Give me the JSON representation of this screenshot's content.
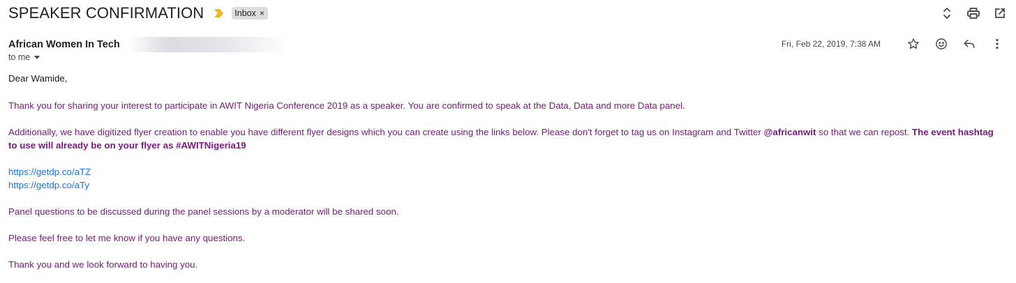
{
  "subject": "SPEAKER CONFIRMATION",
  "label_chip": {
    "text": "Inbox",
    "remove": "×"
  },
  "importance_icon": "importance-marker-icon",
  "top_actions": [
    "expand-collapse-icon",
    "print-icon",
    "open-in-new-window-icon"
  ],
  "sender": {
    "name": "African Women In Tech"
  },
  "recipient": {
    "text": "to me"
  },
  "date": "Fri, Feb 22, 2019, 7:38 AM",
  "meta_actions": [
    "star-icon",
    "emoji-reaction-icon",
    "reply-icon",
    "more-options-icon"
  ],
  "body": {
    "greeting": "Dear Wamide,",
    "p1": "Thank you for sharing your interest to participate in AWIT Nigeria Conference 2019 as a speaker. You are confirmed to speak at the Data, Data and more Data panel.",
    "p2_a": "Additionally, we have digitized flyer creation to enable you have different flyer designs which you can create using the links below. Please don't forget to tag us on Instagram and Twitter ",
    "p2_handle": "@africanwit",
    "p2_b": " so that we can repost. ",
    "p2_bold": "The event hashtag to use will already be on your flyer as #AWITNigeria19",
    "links": [
      "https://getdp.co/aTZ",
      "https://getdp.co/aTy"
    ],
    "p3": "Panel questions to be discussed during the panel sessions by a moderator will be shared soon.",
    "p4": "Please feel free to let me know if you have any questions.",
    "p5": "Thank you and we look forward to having you."
  },
  "colors": {
    "body_text": "#7b1a80",
    "link": "#1a73e8",
    "importance": "#f2b824",
    "chip_bg": "#dddddd"
  }
}
